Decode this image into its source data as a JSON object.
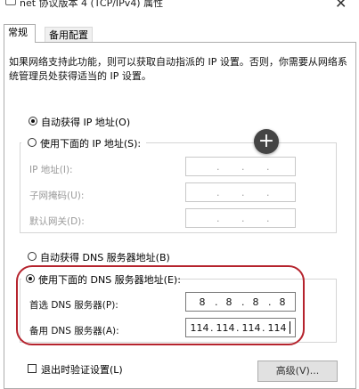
{
  "window": {
    "title": "net 协议版本 4 (TCP/IPv4) 属性",
    "close_glyph": "✕"
  },
  "tabs": [
    {
      "label": "常规",
      "active": true
    },
    {
      "label": "备用配置",
      "active": false
    }
  ],
  "description": "如果网络支持此功能，则可以获取自动指派的 IP 设置。否则，你需要从网络系统管理员处获得适当的 IP 设置。",
  "ip_section": {
    "auto_option": "自动获得 IP 地址(O)",
    "manual_option": "使用下面的 IP 地址(S):",
    "auto_selected": true,
    "fields": [
      {
        "label": "IP 地址(I):",
        "value": ". . ."
      },
      {
        "label": "子网掩码(U):",
        "value": ". . ."
      },
      {
        "label": "默认网关(D):",
        "value": ". . ."
      }
    ]
  },
  "dns_section": {
    "auto_option": "自动获得 DNS 服务器地址(B)",
    "manual_option": "使用下面的 DNS 服务器地址(E):",
    "manual_selected": true,
    "preferred": {
      "label": "首选 DNS 服务器(P):",
      "octets": [
        "8",
        "8",
        "8",
        "8"
      ]
    },
    "alternate": {
      "label": "备用 DNS 服务器(A):",
      "octets": [
        "114",
        "114",
        "114",
        "114"
      ]
    }
  },
  "overlay": {
    "plus_glyph": "+"
  },
  "footer": {
    "validate_label": "退出时验证设置(L)",
    "advanced_button": "高级(V)..."
  },
  "colors": {
    "highlight": "#b5232d",
    "border": "#adadad"
  }
}
